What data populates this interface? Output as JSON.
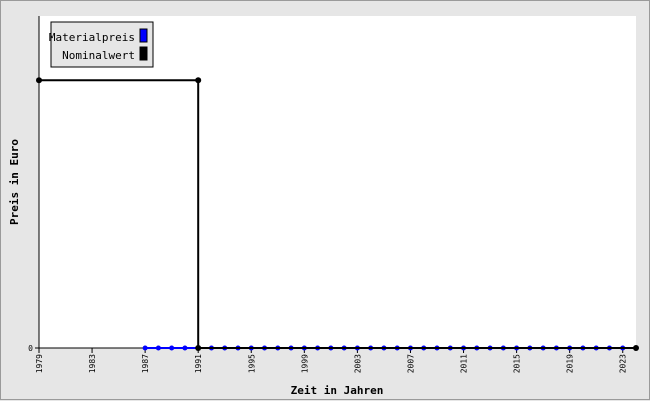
{
  "chart_data": {
    "type": "line",
    "xlabel": "Zeit in Jahren",
    "ylabel": "Preis in Euro",
    "x_ticks": [
      1979,
      1983,
      1987,
      1991,
      1995,
      1999,
      2003,
      2007,
      2011,
      2015,
      2019,
      2023
    ],
    "xlim": [
      1979,
      2024
    ],
    "y_ticks": [
      0
    ],
    "ylim": [
      0,
      1.24
    ],
    "legend_position": "top-left",
    "series": [
      {
        "name": "Materialpreis",
        "color": "#0000ff",
        "marker_color": "#0000ff",
        "points": [
          [
            1987,
            0
          ],
          [
            1988,
            0
          ],
          [
            1989,
            0
          ],
          [
            1990,
            0
          ],
          [
            1991,
            0
          ],
          [
            1992,
            0
          ],
          [
            1993,
            0
          ],
          [
            1994,
            0
          ],
          [
            1995,
            0
          ],
          [
            1996,
            0
          ],
          [
            1997,
            0
          ],
          [
            1998,
            0
          ],
          [
            1999,
            0
          ],
          [
            2000,
            0
          ],
          [
            2001,
            0
          ],
          [
            2002,
            0
          ],
          [
            2003,
            0
          ],
          [
            2004,
            0
          ],
          [
            2005,
            0
          ],
          [
            2006,
            0
          ],
          [
            2007,
            0
          ],
          [
            2008,
            0
          ],
          [
            2009,
            0
          ],
          [
            2010,
            0
          ],
          [
            2011,
            0
          ],
          [
            2012,
            0
          ],
          [
            2013,
            0
          ],
          [
            2014,
            0
          ],
          [
            2015,
            0
          ],
          [
            2016,
            0
          ],
          [
            2017,
            0
          ],
          [
            2018,
            0
          ],
          [
            2019,
            0
          ],
          [
            2020,
            0
          ],
          [
            2021,
            0
          ],
          [
            2022,
            0
          ],
          [
            2023,
            0
          ],
          [
            2024,
            0
          ]
        ]
      },
      {
        "name": "Nominalwert",
        "color": "#000000",
        "marker_color": "#000000",
        "step": true,
        "points": [
          [
            1979,
            1
          ],
          [
            1991,
            1
          ],
          [
            1991,
            0
          ],
          [
            2024,
            0
          ]
        ]
      }
    ]
  }
}
